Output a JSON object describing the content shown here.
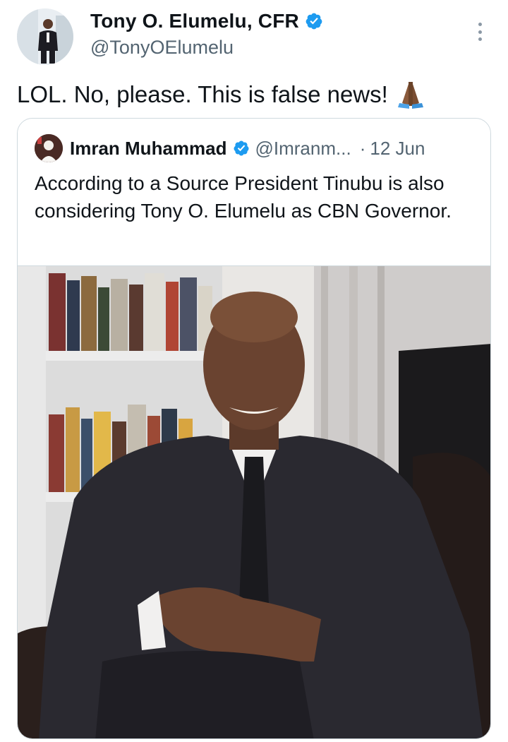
{
  "author": {
    "display_name": "Tony O. Elumelu, CFR",
    "handle": "@TonyOElumelu",
    "verified": true
  },
  "tweet": {
    "text": "LOL. No, please. This is false news!",
    "emoji": "folded-hands-emoji"
  },
  "quoted_tweet": {
    "display_name": "Imran Muhammad",
    "handle": "@Imranm...",
    "separator": "·",
    "time": "12 Jun",
    "verified": true,
    "text": "According to a Source President Tinubu is also considering Tony O. Elumelu as CBN Governor."
  },
  "icons": {
    "verified": "verified-badge-icon",
    "more": "more-options-icon"
  },
  "colors": {
    "verified_blue": "#1d9bf0",
    "text_primary": "#0f1419",
    "text_secondary": "#536471",
    "border": "#cfd9de"
  }
}
